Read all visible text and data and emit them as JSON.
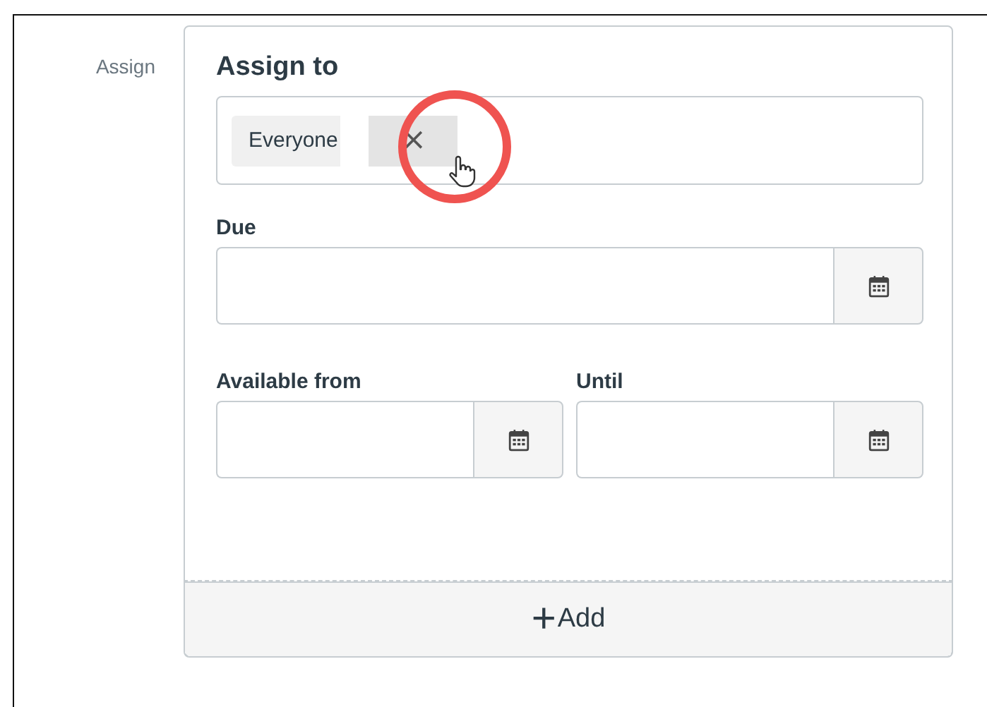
{
  "section_label": "Assign",
  "assign_to": {
    "label": "Assign to",
    "chips": [
      {
        "text": "Everyone",
        "remove": "×",
        "highlighted": true
      }
    ]
  },
  "due": {
    "label": "Due"
  },
  "range": [
    {
      "label": "Available from"
    },
    {
      "label": "Until"
    }
  ],
  "add_button": {
    "icon": "+",
    "text": "Add"
  }
}
